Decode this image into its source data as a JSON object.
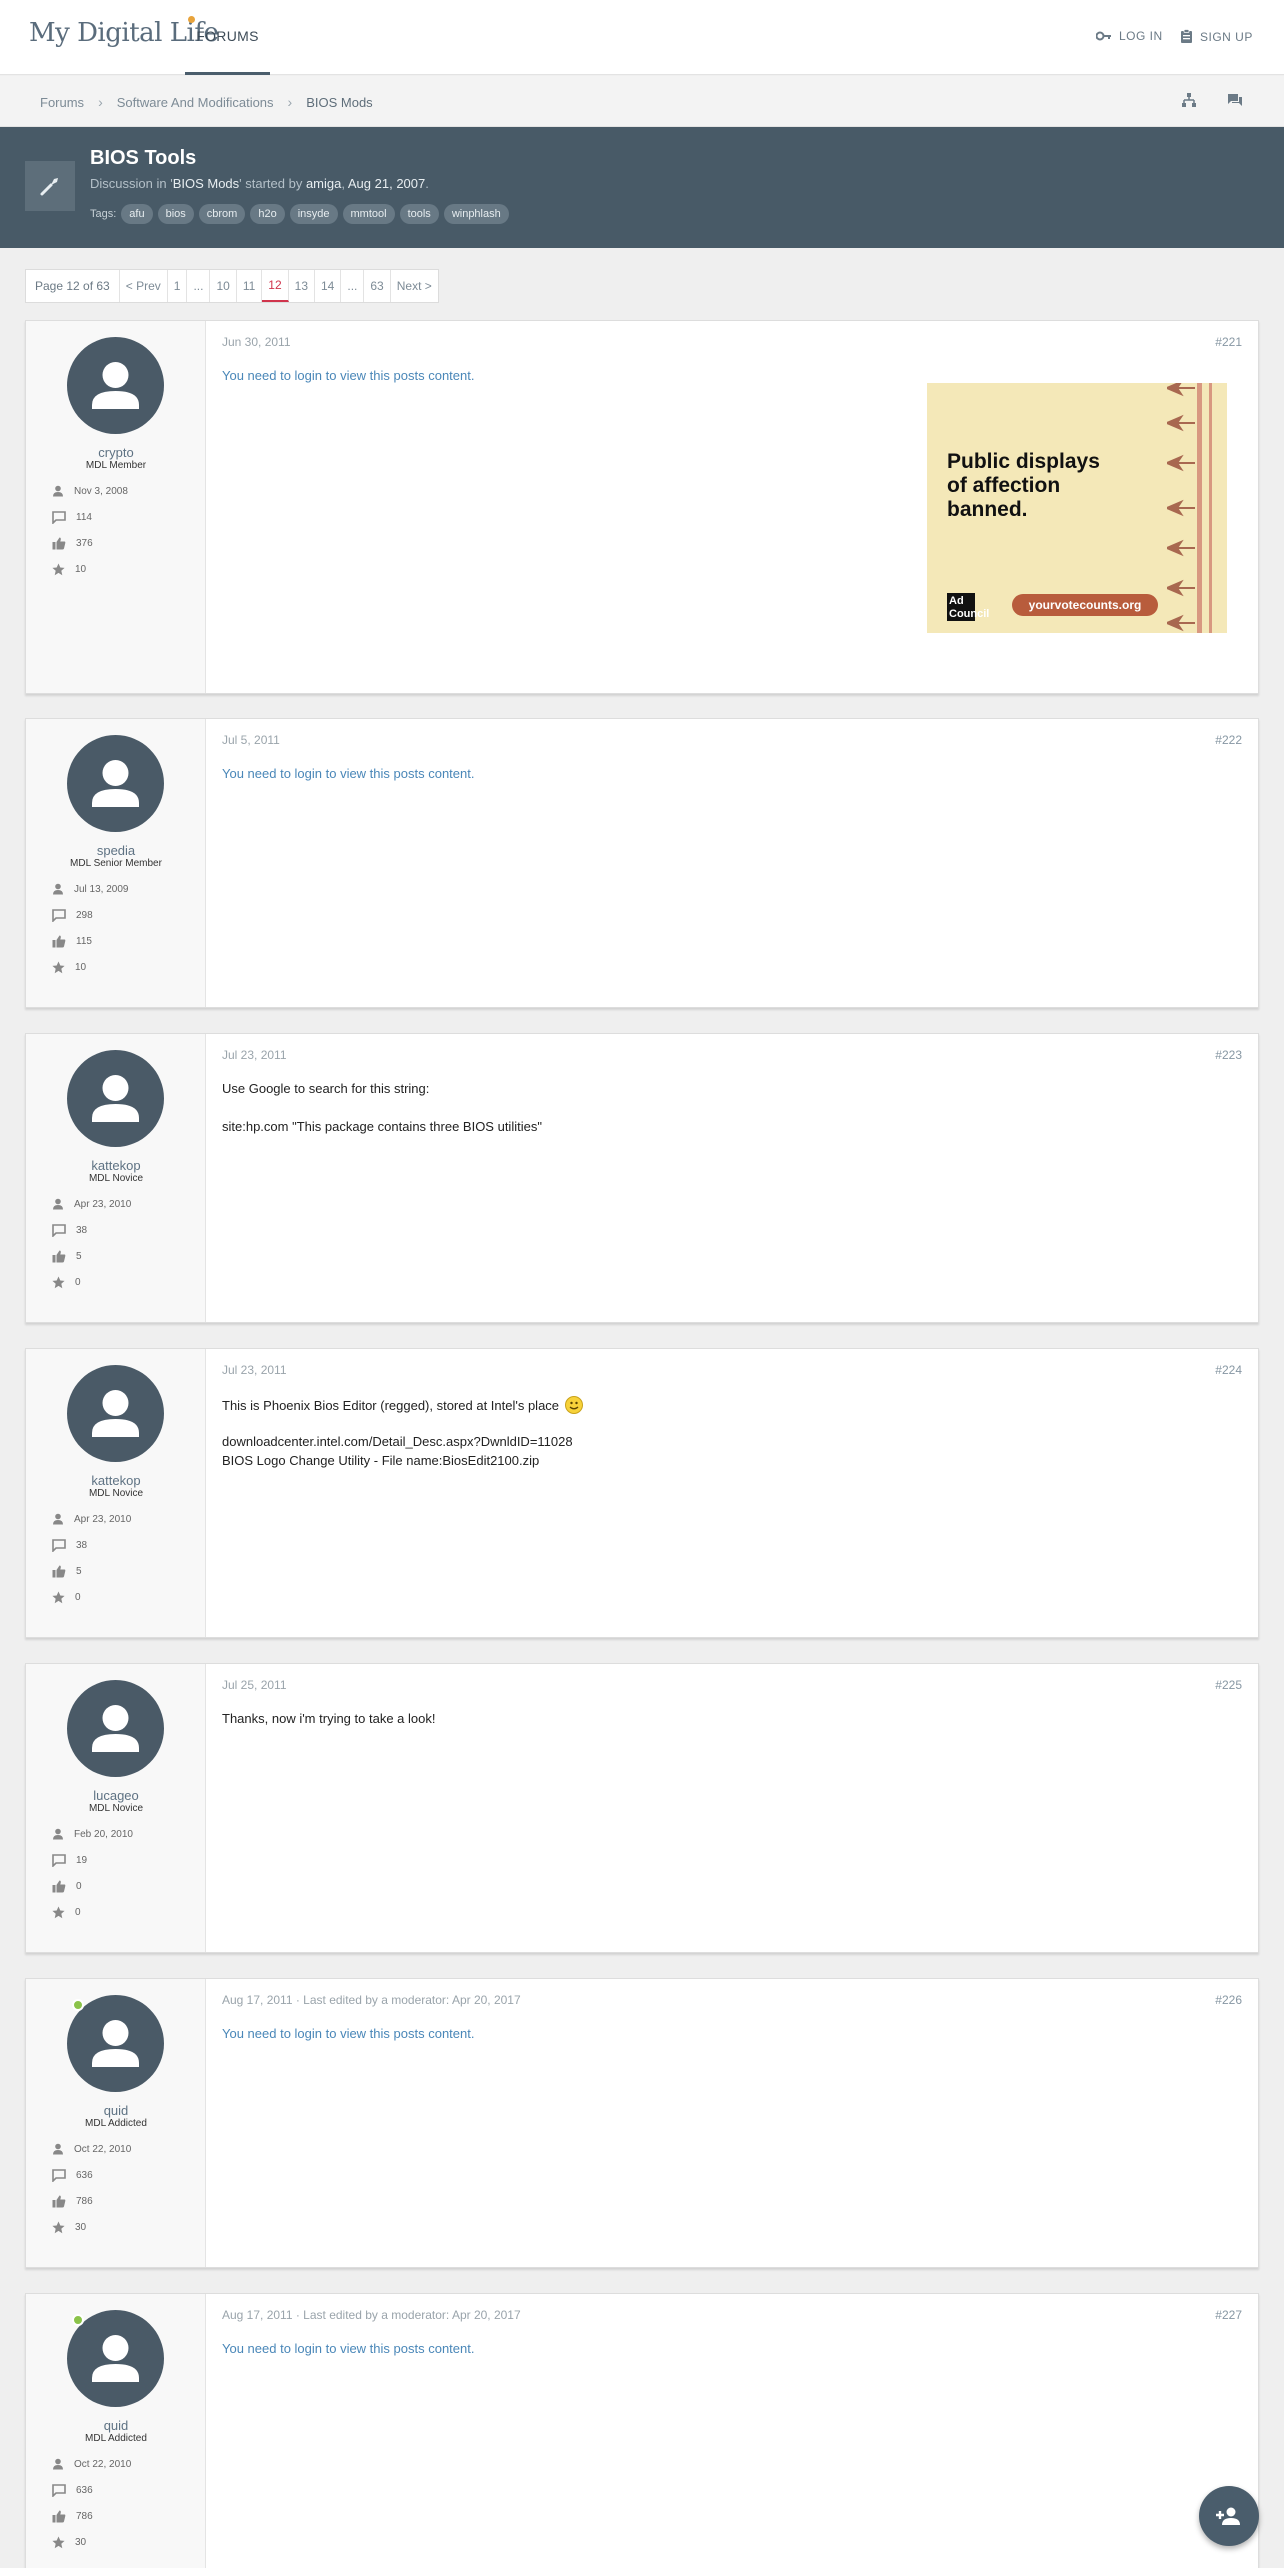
{
  "header": {
    "logo_text": "My Digital Life",
    "nav_forums": "FORUMS",
    "login": "LOG IN",
    "signup": "SIGN UP"
  },
  "breadcrumb": [
    "Forums",
    "Software And Modifications",
    "BIOS Mods"
  ],
  "thread": {
    "title": "BIOS Tools",
    "meta_prefix": "Discussion in '",
    "forum": "BIOS Mods",
    "meta_mid": "' started by ",
    "author": "amiga",
    "date": "Aug 21, 2007",
    "tags_label": "Tags:",
    "tags": [
      "afu",
      "bios",
      "cbrom",
      "h2o",
      "insyde",
      "mmtool",
      "tools",
      "winphlash"
    ]
  },
  "pagination": {
    "label": "Page 12 of 63",
    "prev": "< Prev",
    "pages": [
      "1",
      "...",
      "10",
      "11",
      "12",
      "13",
      "14",
      "...",
      "63"
    ],
    "current": "12",
    "next": "Next >"
  },
  "posts": [
    {
      "username": "crypto",
      "user_title": "MDL Member",
      "joined": "Nov 3, 2008",
      "messages": "114",
      "likes": "376",
      "points": "10",
      "date": "Jun 30, 2011",
      "number": "#221",
      "content_login": "You need to login to view this posts content.",
      "online": false
    },
    {
      "username": "spedia",
      "user_title": "MDL Senior Member",
      "joined": "Jul 13, 2009",
      "messages": "298",
      "likes": "115",
      "points": "10",
      "date": "Jul 5, 2011",
      "number": "#222",
      "content_login": "You need to login to view this posts content.",
      "online": false
    },
    {
      "username": "kattekop",
      "user_title": "MDL Novice",
      "joined": "Apr 23, 2010",
      "messages": "38",
      "likes": "5",
      "points": "0",
      "date": "Jul 23, 2011",
      "number": "#223",
      "lines": [
        "Use Google to search for this string:",
        "site:hp.com \"This package contains three BIOS utilities\""
      ],
      "online": false
    },
    {
      "username": "kattekop",
      "user_title": "MDL Novice",
      "joined": "Apr 23, 2010",
      "messages": "38",
      "likes": "5",
      "points": "0",
      "date": "Jul 23, 2011",
      "number": "#224",
      "lines": [
        "This is Phoenix Bios Editor (regged), stored at Intel's place",
        "downloadcenter.intel.com/Detail_Desc.aspx?DwnldID=11028",
        "BIOS Logo Change Utility - File name:BiosEdit2100.zip"
      ],
      "online": false
    },
    {
      "username": "lucageo",
      "user_title": "MDL Novice",
      "joined": "Feb 20, 2010",
      "messages": "19",
      "likes": "0",
      "points": "0",
      "date": "Jul 25, 2011",
      "number": "#225",
      "lines": [
        "Thanks, now i'm trying to take a look!"
      ],
      "online": false
    },
    {
      "username": "quid",
      "user_title": "MDL Addicted",
      "joined": "Oct 22, 2010",
      "messages": "636",
      "likes": "786",
      "points": "30",
      "date": "Aug 17, 2011",
      "edited": "Last edited by a moderator: Apr 20, 2017",
      "number": "#226",
      "content_login": "You need to login to view this posts content.",
      "online": true
    },
    {
      "username": "quid",
      "user_title": "MDL Addicted",
      "joined": "Oct 22, 2010",
      "messages": "636",
      "likes": "786",
      "points": "30",
      "date": "Aug 17, 2011",
      "edited": "Last edited by a moderator: Apr 20, 2017",
      "number": "#227",
      "content_login": "You need to login to view this posts content.",
      "online": true
    }
  ],
  "ad": {
    "headline_1": "Public displays",
    "headline_2": "of affection",
    "headline_3": "banned.",
    "badge": "Ad Council",
    "url": "yourvotecounts.org",
    "colors": {
      "background": "#f4e8b8",
      "accent": "#b85c3c"
    }
  },
  "icons": {
    "login": "key-icon",
    "signup": "clipboard-icon",
    "sitemap": "sitemap-icon",
    "comments": "comments-icon",
    "thread": "wrench-icon",
    "fab": "person-add-icon"
  },
  "colors": {
    "thread_header": "#485a67",
    "active_page": "#d0344c",
    "link": "#4a87b8",
    "online": "#8bc34a"
  }
}
